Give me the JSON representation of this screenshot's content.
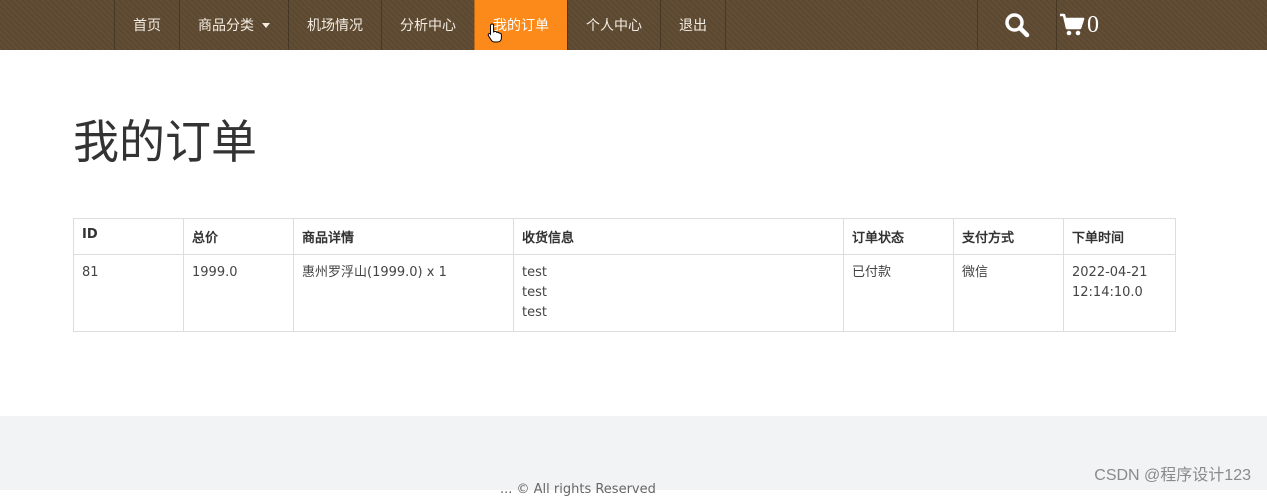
{
  "nav": {
    "items": [
      {
        "label": "首页"
      },
      {
        "label": "商品分类"
      },
      {
        "label": "机场情况"
      },
      {
        "label": "分析中心"
      },
      {
        "label": "我的订单"
      },
      {
        "label": "个人中心"
      },
      {
        "label": "退出"
      }
    ],
    "active_index": 4,
    "cart_count": "0",
    "search_icon": "search-icon",
    "cart_icon": "cart-icon"
  },
  "page": {
    "title": "我的订单"
  },
  "orders": {
    "headers": [
      "ID",
      "总价",
      "商品详情",
      "收货信息",
      "订单状态",
      "支付方式",
      "下单时间"
    ],
    "rows": [
      {
        "id": "81",
        "total": "1999.0",
        "detail": "惠州罗浮山(1999.0) x 1",
        "shipping": [
          "test",
          "test",
          "test"
        ],
        "status": "已付款",
        "payment": "微信",
        "time_date": "2022-04-21",
        "time_clock": "12:14:10.0"
      }
    ]
  },
  "footer": {
    "text": "... © All rights Reserved"
  },
  "watermark": "CSDN @程序设计123",
  "colors": {
    "navbar_bg": "#5e4a31",
    "active_bg": "#fb8a1a",
    "status_paid": "#e0564a",
    "footer_bg": "#f1f3f5"
  }
}
